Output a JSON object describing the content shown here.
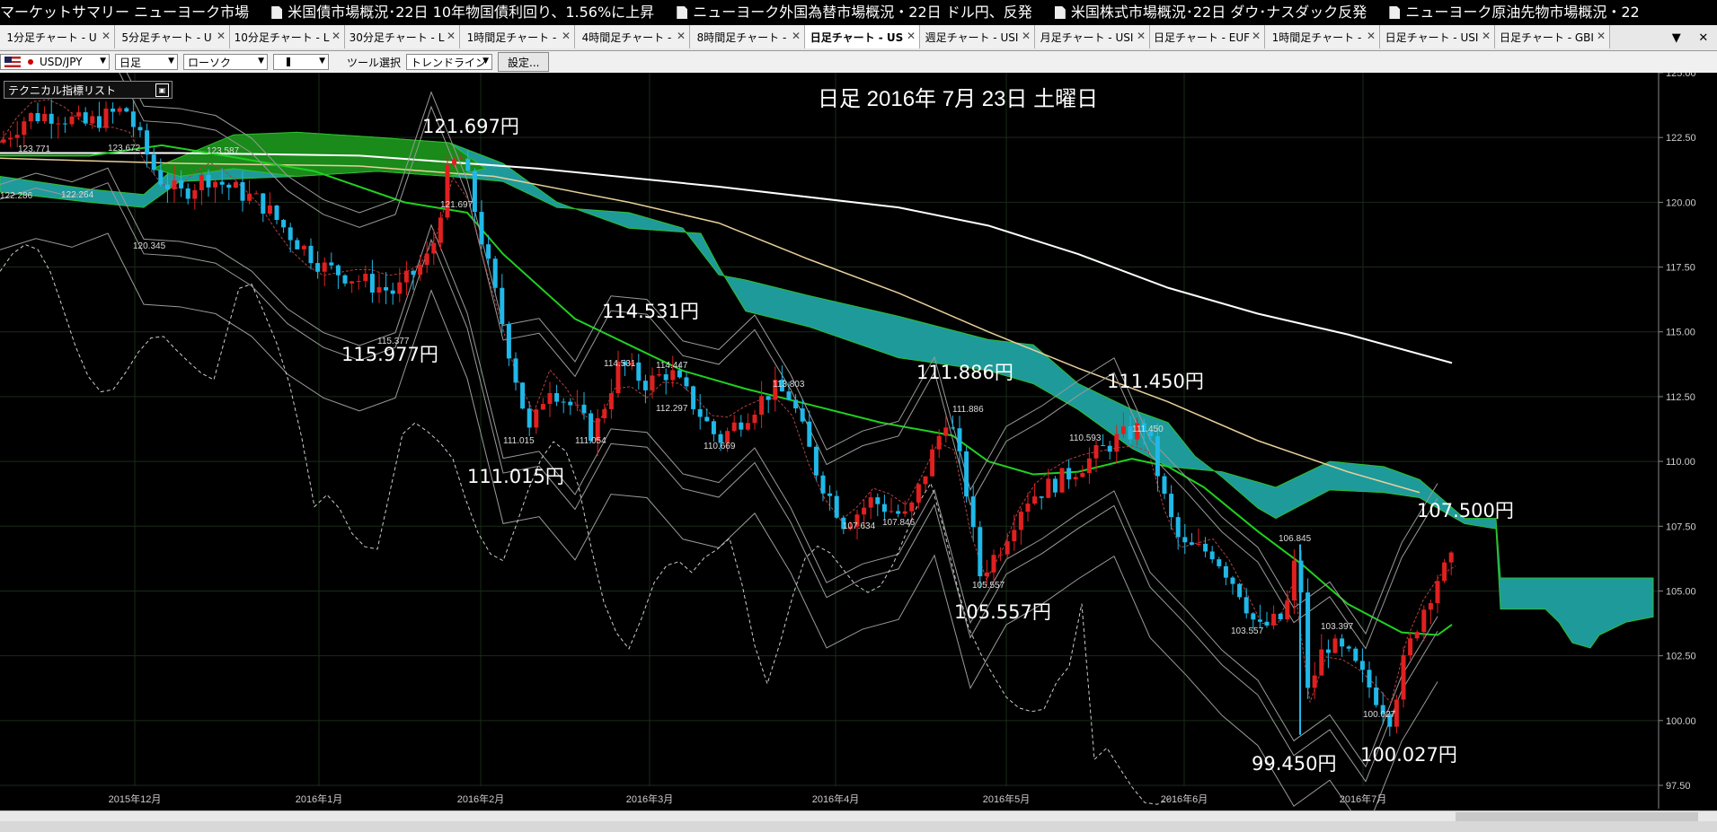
{
  "ticker": {
    "lead": "マーケットサマリー ニューヨーク市場",
    "items": [
      "米国債市場概況･22日 10年物国債利回り、1.56%に上昇",
      "ニューヨーク外国為替市場概況・22日 ドル円、反発",
      "米国株式市場概況･22日 ダウ･ナスダック反発",
      "ニューヨーク原油先物市場概況・22"
    ]
  },
  "tabs": [
    {
      "label": "1分足チャート - U"
    },
    {
      "label": "5分足チャート - U"
    },
    {
      "label": "10分足チャート - L"
    },
    {
      "label": "30分足チャート - L"
    },
    {
      "label": "1時間足チャート -"
    },
    {
      "label": "4時間足チャート -"
    },
    {
      "label": "8時間足チャート -"
    },
    {
      "label": "日足チャート - US",
      "active": true
    },
    {
      "label": "週足チャート - USI"
    },
    {
      "label": "月足チャート - USI"
    },
    {
      "label": "日足チャート - EUF"
    },
    {
      "label": "1時間足チャート -"
    },
    {
      "label": "日足チャート - USI"
    },
    {
      "label": "日足チャート - GBI"
    }
  ],
  "tab_controls": {
    "scroll": "▼",
    "close": "✕"
  },
  "toolbar": {
    "pair": "USD/JPY",
    "timeframe": "日足",
    "chart_type": "ローソク",
    "tool_label": "ツール選択",
    "tool": "トレンドライン",
    "settings": "設定..."
  },
  "indicator_list": "テクニカル指標リスト",
  "chart_title": "日足 2016年 7月 23日 土曜日",
  "colors": {
    "up": "#e02020",
    "down": "#20b8e8",
    "kumo": "#1e9a9a",
    "kumo_green": "#1a8a1a",
    "ma_green": "#20d020",
    "ma_tan": "#e8d09a"
  },
  "chart_data": {
    "type": "candlestick",
    "y_ticks": [
      "97.50",
      "100.00",
      "102.50",
      "105.00",
      "107.50",
      "110.00",
      "112.50",
      "115.00",
      "117.50",
      "120.00",
      "122.50",
      "125.00"
    ],
    "y_range": [
      97.5,
      125.0
    ],
    "x_ticks": [
      "2015年12月",
      "2016年1月",
      "2016年2月",
      "2016年3月",
      "2016年4月",
      "2016年5月",
      "2016年6月",
      "2016年7月"
    ],
    "annotations_large": [
      "121.697円",
      "115.977円",
      "114.531円",
      "111.015円",
      "111.886円",
      "111.450円",
      "105.557円",
      "107.500円",
      "99.450円",
      "100.027円"
    ],
    "annotations_small": [
      "123.771",
      "123.672",
      "123.587",
      "122.286",
      "122.264",
      "121.697",
      "120.345",
      "115.377",
      "114.531",
      "114.447",
      "113.803",
      "112.297",
      "111.886",
      "111.450",
      "110.593",
      "110.669",
      "111.015",
      "111.054",
      "107.634",
      "107.846",
      "105.557",
      "106.845",
      "103.557",
      "103.397",
      "100.027"
    ]
  }
}
